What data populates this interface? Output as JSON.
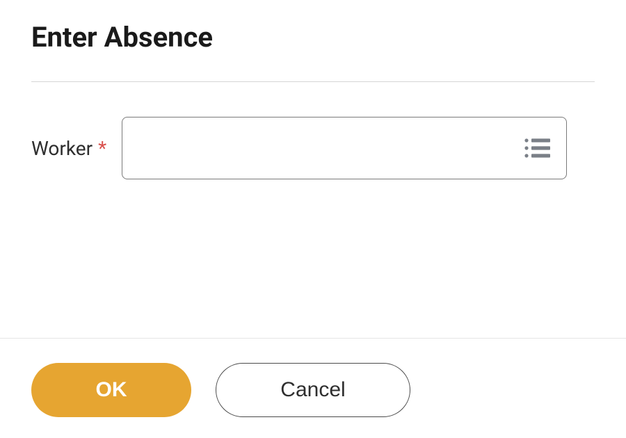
{
  "header": {
    "title": "Enter Absence"
  },
  "form": {
    "worker": {
      "label": "Worker",
      "required_marker": "*",
      "value": "",
      "placeholder": ""
    }
  },
  "buttons": {
    "ok_label": "OK",
    "cancel_label": "Cancel"
  },
  "colors": {
    "primary": "#e6a531",
    "required": "#d9534f"
  }
}
